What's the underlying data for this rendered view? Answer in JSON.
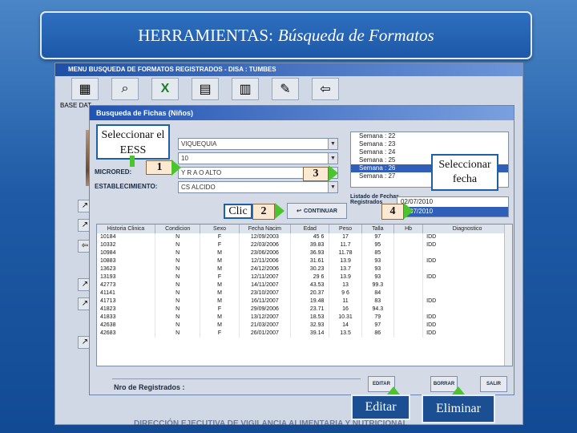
{
  "slide": {
    "title_plain": "HERRAMIENTAS:",
    "title_italic": "Búsqueda de Formatos"
  },
  "app": {
    "window_title": "MENU BUSQUEDA DE FORMATOS REGISTRADOS - DISA : TUMBES",
    "base_label": "BASE DAT",
    "footer_text": "DIRECCIÓN EJECUTIVA DE VIGILANCIA ALIMENTARIA Y NUTRICIONAL"
  },
  "dialog": {
    "title": "Busqueda de Fichas (Niños)",
    "fields": {
      "microred_label": "MICRORED:",
      "establecimiento_label": "ESTABLECIMIENTO:",
      "red_value": "VIQUEQUIA",
      "line2_value": "10",
      "microred_value": "Y  R  A  O  ALTO",
      "establecimiento_value": "CS ALCIDO"
    },
    "weeks": [
      "Semana : 22",
      "Semana : 23",
      "Semana : 24",
      "Semana : 25",
      "Semana : 26",
      "Semana : 27"
    ],
    "selected_week_index": 4,
    "dates_label_line1": "Listado de Fechas",
    "dates_label_line2": "Registrados",
    "dates": [
      "02/07/2010",
      "01/07/2010"
    ],
    "selected_date_index": 1,
    "continuar_label": "CONTINUAR",
    "table": {
      "headers": [
        "Historia Clinica",
        "Condicion",
        "Sexo",
        "Fecha Nacim",
        "Edad",
        "Peso",
        "Talla",
        "Hb",
        "Diagnostico"
      ],
      "rows": [
        [
          "10184",
          "N",
          "F",
          "12/09/2003",
          "45 6",
          "17",
          "97",
          "",
          "IDD"
        ],
        [
          "10332",
          "N",
          "F",
          "22/03/2006",
          "39.83",
          "11.7",
          "95",
          "",
          "IDD"
        ],
        [
          "10984",
          "N",
          "M",
          "23/06/2006",
          "36.93",
          "11.78",
          "85",
          "",
          ""
        ],
        [
          "10883",
          "N",
          "M",
          "12/11/2006",
          "31.61",
          "13.9",
          "93",
          "",
          "IDD"
        ],
        [
          "13623",
          "N",
          "M",
          "24/12/2006",
          "30.23",
          "13.7",
          "93",
          "",
          ""
        ],
        [
          "13193",
          "N",
          "F",
          "12/11/2007",
          "29 6",
          "13.9",
          "93",
          "",
          "IDD"
        ],
        [
          "42773",
          "N",
          "M",
          "14/11/2007",
          "43.53",
          "13",
          "99.3",
          "",
          ""
        ],
        [
          "41141",
          "N",
          "M",
          "23/10/2007",
          "20.37",
          "9 6",
          "84",
          "",
          ""
        ],
        [
          "41713",
          "N",
          "M",
          "16/11/2007",
          "19.48",
          "11",
          "83",
          "",
          "IDD"
        ],
        [
          "41823",
          "N",
          "F",
          "29/09/2006",
          "23.71",
          "16",
          "94.3",
          "",
          ""
        ],
        [
          "41833",
          "N",
          "M",
          "13/12/2007",
          "18.53",
          "10.31",
          "79",
          "",
          "IDD"
        ],
        [
          "42638",
          "N",
          "M",
          "21/03/2007",
          "32.93",
          "14",
          "97",
          "",
          "IDD"
        ],
        [
          "42683",
          "N",
          "F",
          "26/01/2007",
          "39.14",
          "13.5",
          "86",
          "",
          "IDD"
        ]
      ]
    },
    "nro_label": "Nro de Registrados :",
    "bottom_buttons": [
      "EDITAR",
      "BORRAR",
      "SALIR"
    ]
  },
  "callouts": {
    "eess": "Seleccionar el EESS",
    "fecha": "Seleccionar fecha",
    "clic": "Clic",
    "editar": "Editar",
    "eliminar": "Eliminar"
  },
  "badges": [
    "1",
    "2",
    "3",
    "4"
  ],
  "colors": {
    "background": "#1e5aa6",
    "arrow": "#4cc42e",
    "selection": "#2f5fb8"
  }
}
